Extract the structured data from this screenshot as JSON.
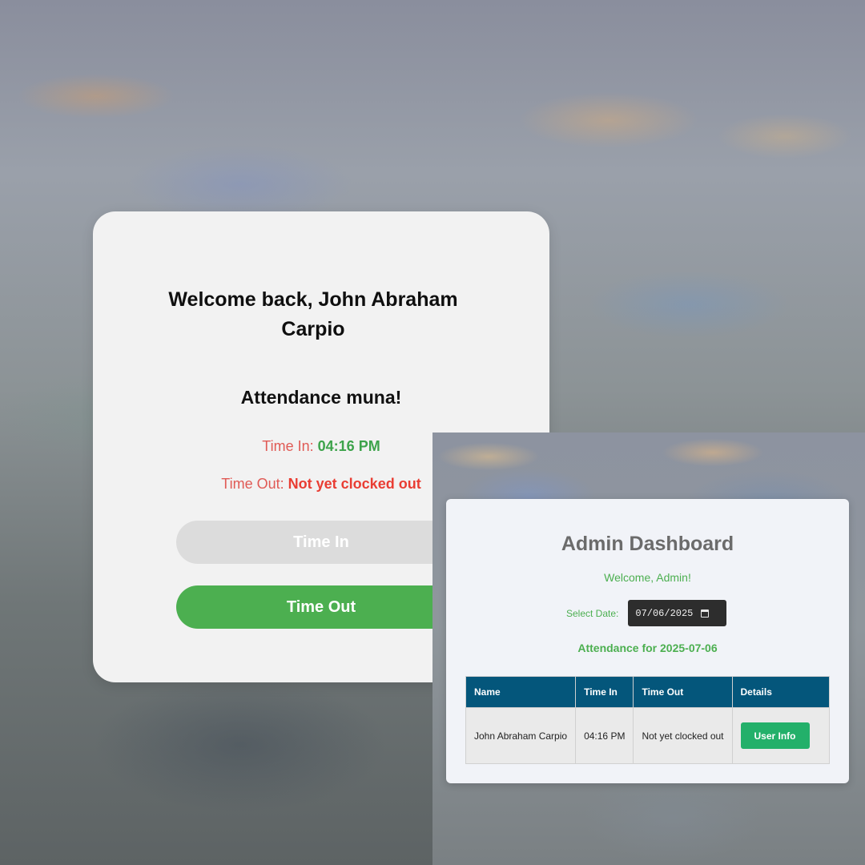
{
  "user_panel": {
    "welcome_text": "Welcome back, John Abraham Carpio",
    "subtitle": "Attendance muna!",
    "time_in_label": "Time In: ",
    "time_in_value": "04:16 PM",
    "time_out_label": "Time Out: ",
    "time_out_value": "Not yet clocked out",
    "time_in_button": "Time In",
    "time_out_button": "Time Out"
  },
  "admin_panel": {
    "title": "Admin Dashboard",
    "welcome": "Welcome, Admin!",
    "date_label": "Select Date:",
    "date_value": "07/06/2025",
    "attendance_heading": "Attendance for 2025-07-06",
    "table": {
      "columns": [
        "Name",
        "Time In",
        "Time Out",
        "Details"
      ],
      "rows": [
        {
          "name": "John Abraham Carpio",
          "time_in": "04:16 PM",
          "time_out": "Not yet clocked out",
          "details_button": "User Info"
        }
      ]
    }
  },
  "colors": {
    "accent_green": "#4caf50",
    "alert_red": "#e93d33",
    "table_header": "#04567b",
    "info_button": "#23b06a",
    "disabled_button": "#dcdcdc"
  },
  "icons": {
    "date_picker": "calendar-icon"
  }
}
